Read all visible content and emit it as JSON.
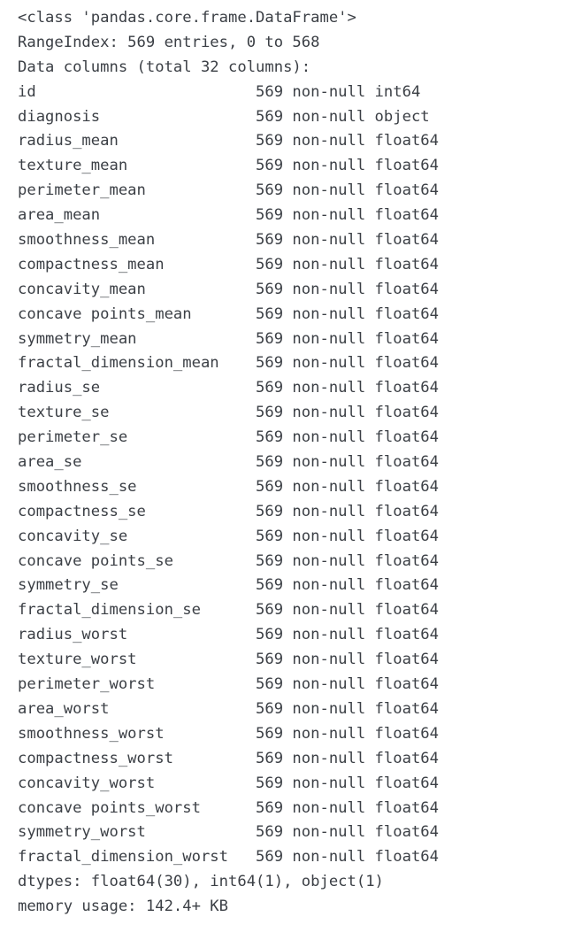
{
  "output": {
    "kind": "pandas-dataframe-info",
    "header_lines": [
      "<class 'pandas.core.frame.DataFrame'>",
      "RangeIndex: 569 entries, 0 to 568",
      "Data columns (total 32 columns):"
    ],
    "name_column_width": 26,
    "columns": [
      {
        "name": "id",
        "count": "569 non-null",
        "dtype": "int64"
      },
      {
        "name": "diagnosis",
        "count": "569 non-null",
        "dtype": "object"
      },
      {
        "name": "radius_mean",
        "count": "569 non-null",
        "dtype": "float64"
      },
      {
        "name": "texture_mean",
        "count": "569 non-null",
        "dtype": "float64"
      },
      {
        "name": "perimeter_mean",
        "count": "569 non-null",
        "dtype": "float64"
      },
      {
        "name": "area_mean",
        "count": "569 non-null",
        "dtype": "float64"
      },
      {
        "name": "smoothness_mean",
        "count": "569 non-null",
        "dtype": "float64"
      },
      {
        "name": "compactness_mean",
        "count": "569 non-null",
        "dtype": "float64"
      },
      {
        "name": "concavity_mean",
        "count": "569 non-null",
        "dtype": "float64"
      },
      {
        "name": "concave points_mean",
        "count": "569 non-null",
        "dtype": "float64"
      },
      {
        "name": "symmetry_mean",
        "count": "569 non-null",
        "dtype": "float64"
      },
      {
        "name": "fractal_dimension_mean",
        "count": "569 non-null",
        "dtype": "float64"
      },
      {
        "name": "radius_se",
        "count": "569 non-null",
        "dtype": "float64"
      },
      {
        "name": "texture_se",
        "count": "569 non-null",
        "dtype": "float64"
      },
      {
        "name": "perimeter_se",
        "count": "569 non-null",
        "dtype": "float64"
      },
      {
        "name": "area_se",
        "count": "569 non-null",
        "dtype": "float64"
      },
      {
        "name": "smoothness_se",
        "count": "569 non-null",
        "dtype": "float64"
      },
      {
        "name": "compactness_se",
        "count": "569 non-null",
        "dtype": "float64"
      },
      {
        "name": "concavity_se",
        "count": "569 non-null",
        "dtype": "float64"
      },
      {
        "name": "concave points_se",
        "count": "569 non-null",
        "dtype": "float64"
      },
      {
        "name": "symmetry_se",
        "count": "569 non-null",
        "dtype": "float64"
      },
      {
        "name": "fractal_dimension_se",
        "count": "569 non-null",
        "dtype": "float64"
      },
      {
        "name": "radius_worst",
        "count": "569 non-null",
        "dtype": "float64"
      },
      {
        "name": "texture_worst",
        "count": "569 non-null",
        "dtype": "float64"
      },
      {
        "name": "perimeter_worst",
        "count": "569 non-null",
        "dtype": "float64"
      },
      {
        "name": "area_worst",
        "count": "569 non-null",
        "dtype": "float64"
      },
      {
        "name": "smoothness_worst",
        "count": "569 non-null",
        "dtype": "float64"
      },
      {
        "name": "compactness_worst",
        "count": "569 non-null",
        "dtype": "float64"
      },
      {
        "name": "concavity_worst",
        "count": "569 non-null",
        "dtype": "float64"
      },
      {
        "name": "concave points_worst",
        "count": "569 non-null",
        "dtype": "float64"
      },
      {
        "name": "symmetry_worst",
        "count": "569 non-null",
        "dtype": "float64"
      },
      {
        "name": "fractal_dimension_worst",
        "count": "569 non-null",
        "dtype": "float64"
      }
    ],
    "footer_lines": [
      "dtypes: float64(30), int64(1), object(1)",
      "memory usage: 142.4+ KB"
    ]
  }
}
